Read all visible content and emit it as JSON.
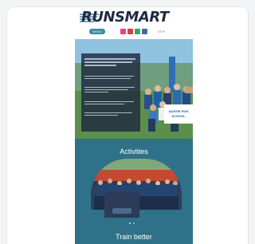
{
  "site": {
    "logo": "RUNSMART",
    "menu_label": "MENU",
    "lang": "ES ▾"
  },
  "hero": {
    "banner_text": "AUSSIE RUN SCHOOL"
  },
  "sections": {
    "activities_title": "Activities",
    "train_title": "Train better"
  },
  "colors": {
    "page_bg": "#2f7188",
    "header_bg": "#ffffff",
    "panel_bg": "#1f293f",
    "accent": "#3e8a9c"
  }
}
